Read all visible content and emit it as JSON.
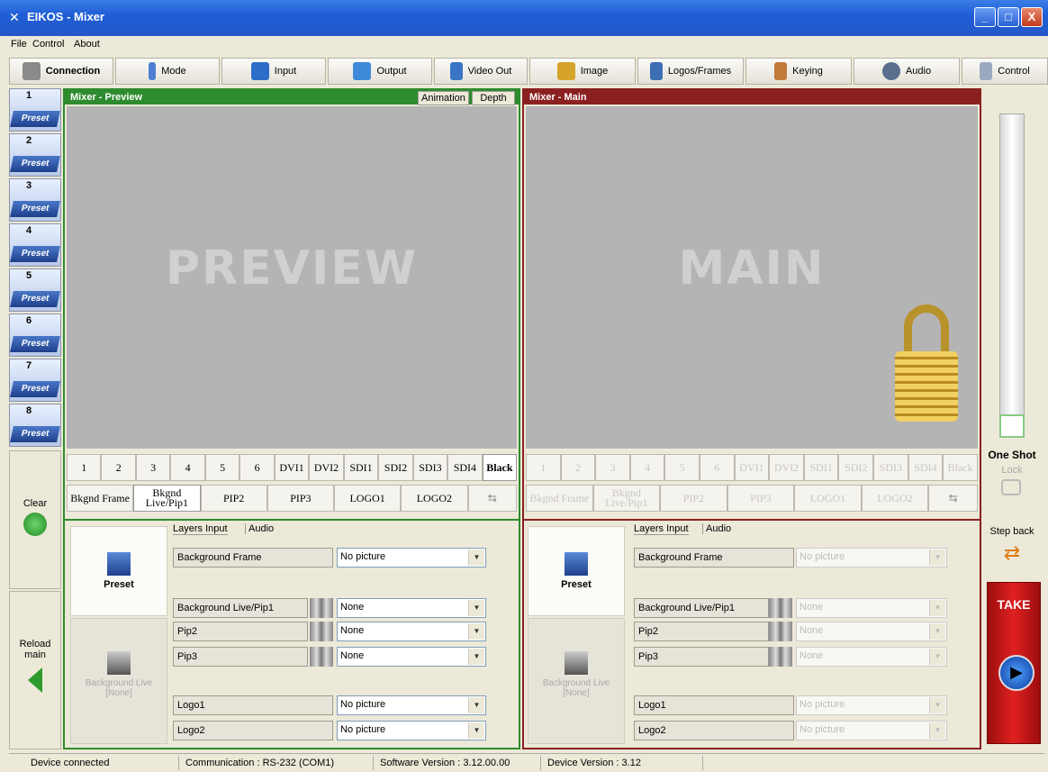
{
  "window": {
    "title": "EIKOS - Mixer",
    "min": "_",
    "max": "□",
    "close": "X"
  },
  "menu": [
    "File",
    "Control",
    "About"
  ],
  "toolbar": [
    "Connection",
    "Mode",
    "Input",
    "Output",
    "Video Out",
    "Image",
    "Logos/Frames",
    "Keying",
    "Audio",
    "Control"
  ],
  "presets": [
    {
      "num": "1",
      "label": "Preset"
    },
    {
      "num": "2",
      "label": "Preset"
    },
    {
      "num": "3",
      "label": "Preset"
    },
    {
      "num": "4",
      "label": "Preset"
    },
    {
      "num": "5",
      "label": "Preset"
    },
    {
      "num": "6",
      "label": "Preset"
    },
    {
      "num": "7",
      "label": "Preset"
    },
    {
      "num": "8",
      "label": "Preset"
    }
  ],
  "left_buttons": {
    "clear": "Clear",
    "reload": "Reload main"
  },
  "preview": {
    "title": "Mixer - Preview",
    "tabs": [
      "Animation",
      "Depth"
    ],
    "big_text": "PREVIEW",
    "sources": [
      "1",
      "2",
      "3",
      "4",
      "5",
      "6",
      "DVI1",
      "DVI2",
      "SDI1",
      "SDI2",
      "SDI3",
      "SDI4",
      "Black"
    ],
    "layers": [
      "Bkgnd Frame",
      "Bkgnd Live/Pip1",
      "PIP2",
      "PIP3",
      "LOGO1",
      "LOGO2"
    ]
  },
  "main": {
    "title": "Mixer - Main",
    "big_text": "MAIN",
    "sources": [
      "1",
      "2",
      "3",
      "4",
      "5",
      "6",
      "DVI1",
      "DVI2",
      "SDI1",
      "SDI2",
      "SDI3",
      "SDI4",
      "Black"
    ],
    "layers": [
      "Bkgnd Frame",
      "Bkgnd Live/Pip1",
      "PIP2",
      "PIP3",
      "LOGO1",
      "LOGO2"
    ]
  },
  "layer_tabs": [
    "Layers Input",
    "Audio"
  ],
  "preset_label": "Preset",
  "bg_live_label": "Background Live [None]",
  "layer_rows": [
    {
      "label": "Background Frame",
      "value": "No picture"
    },
    {
      "label": "Background Live/Pip1",
      "value": "None"
    },
    {
      "label": "Pip2",
      "value": "None"
    },
    {
      "label": "Pip3",
      "value": "None"
    },
    {
      "label": "Logo1",
      "value": "No picture"
    },
    {
      "label": "Logo2",
      "value": "No picture"
    }
  ],
  "right_col": {
    "one_shot": "One Shot",
    "lock": "Lock",
    "step_back": "Step back",
    "take": "TAKE"
  },
  "status": [
    "Device connected",
    "Communication : RS-232 (COM1)",
    "Software Version : 3.12.00.00",
    "Device Version : 3.12"
  ],
  "colors": {
    "preview_border": "#2e8b2e",
    "main_border": "#8b2020",
    "take_red": "#d01818"
  }
}
